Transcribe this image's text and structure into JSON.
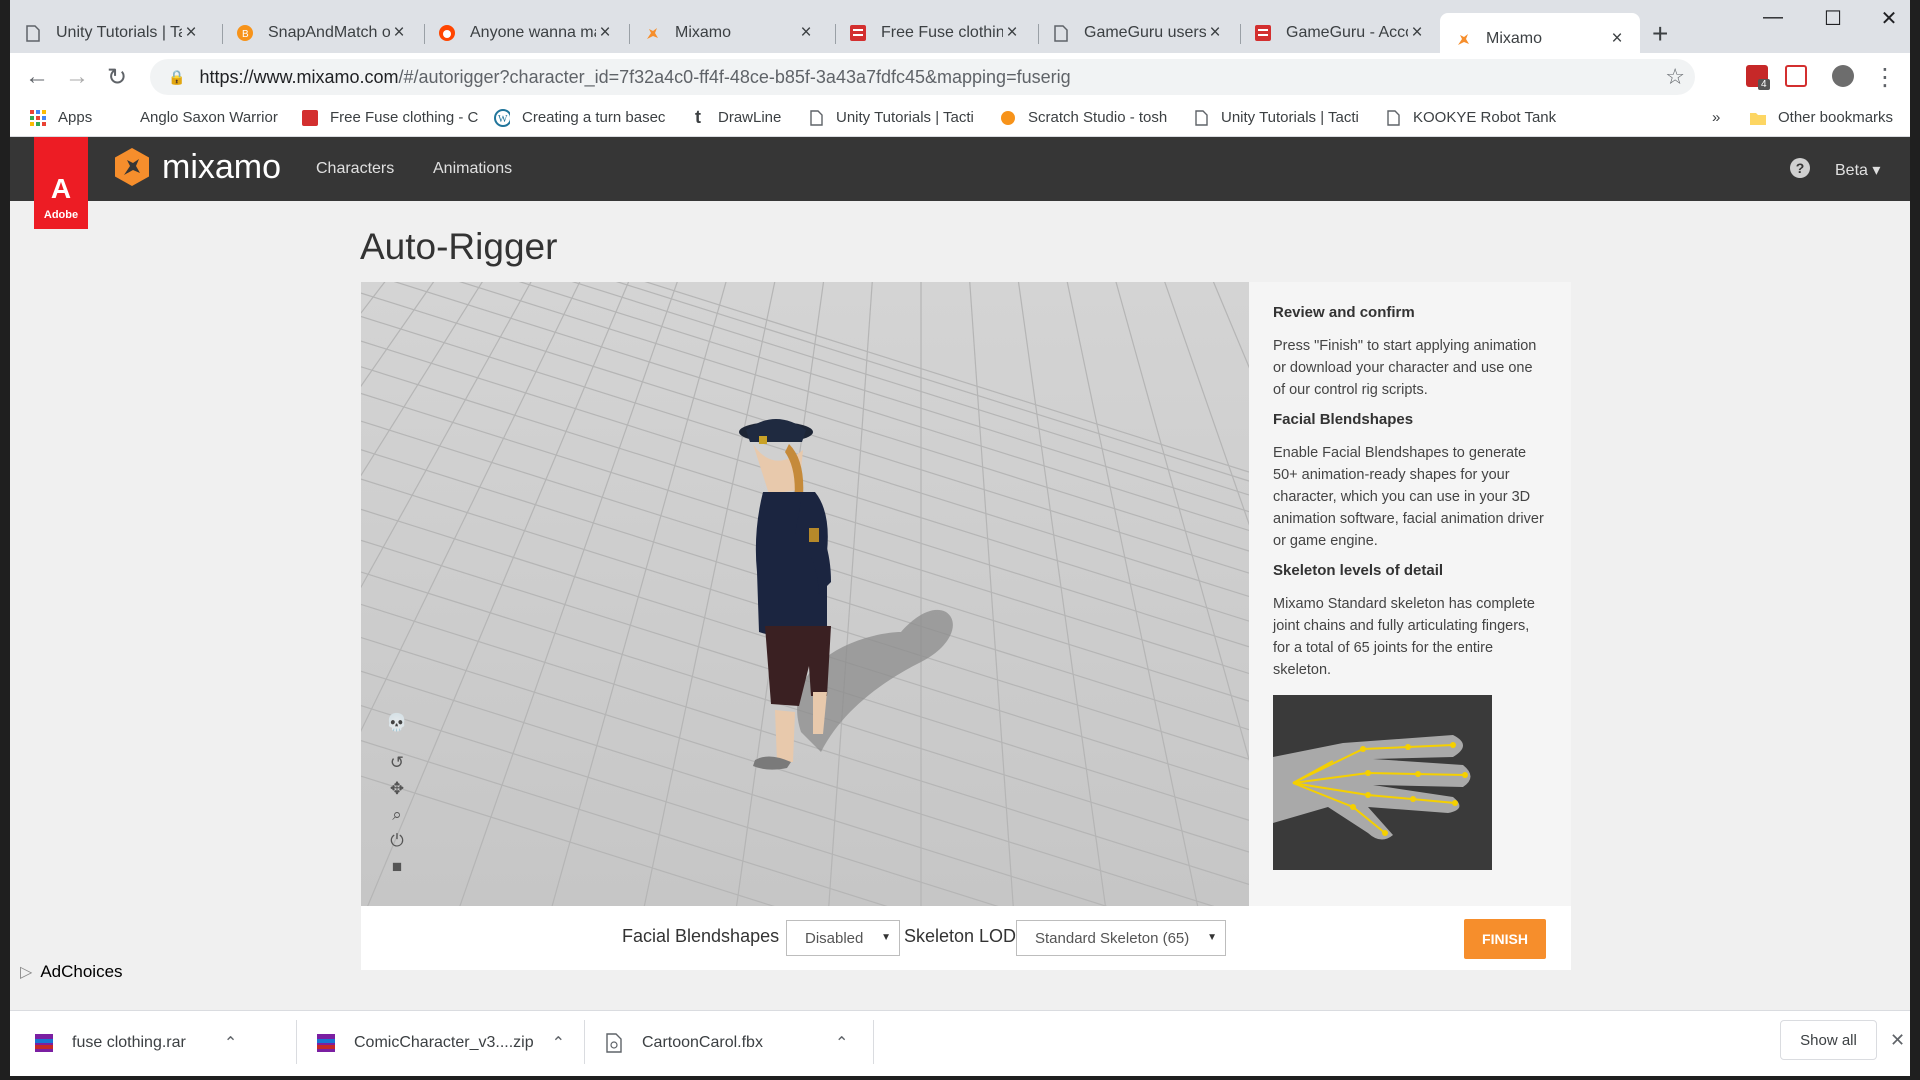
{
  "browser": {
    "tabs": [
      {
        "title": "Unity Tutorials | Ta",
        "icon": "page-icon"
      },
      {
        "title": "SnapAndMatch on",
        "icon": "orange-b-icon"
      },
      {
        "title": "Anyone wanna ma",
        "icon": "reddit-icon"
      },
      {
        "title": "Mixamo",
        "icon": "mixamo-icon"
      },
      {
        "title": "Free Fuse clothing",
        "icon": "gameguru-icon"
      },
      {
        "title": "GameGuru users -",
        "icon": "page-icon"
      },
      {
        "title": "GameGuru - Acco",
        "icon": "gameguru-icon"
      },
      {
        "title": "Mixamo",
        "icon": "mixamo-icon"
      }
    ],
    "url_host": "https://www.mixamo.com",
    "url_rest": "/#/autorigger?character_id=7f32a4c0-ff4f-48ce-b85f-3a43a7fdfc45&mapping=fuserig",
    "ext_badge": "4"
  },
  "bookmarks": [
    {
      "label": "Apps",
      "icon": "apps-grid-icon"
    },
    {
      "label": "Anglo Saxon Warrior",
      "icon": ""
    },
    {
      "label": "Free Fuse clothing - C",
      "icon": "gameguru-icon"
    },
    {
      "label": "Creating a turn basec",
      "icon": "wordpress-icon"
    },
    {
      "label": "DrawLine",
      "icon": "tumblr-icon"
    },
    {
      "label": "Unity Tutorials | Tacti",
      "icon": "page-icon"
    },
    {
      "label": "Scratch Studio - tosh",
      "icon": "orange-b-icon"
    },
    {
      "label": "Unity Tutorials | Tacti",
      "icon": "page-icon"
    },
    {
      "label": "KOOKYE Robot Tank",
      "icon": "page-icon"
    },
    {
      "label": "»",
      "icon": ""
    },
    {
      "label": "Other bookmarks",
      "icon": "folder-icon"
    }
  ],
  "mixamo": {
    "adobe_label": "Adobe",
    "logo_text": "mixamo",
    "nav": {
      "characters": "Characters",
      "animations": "Animations"
    },
    "help": "?",
    "beta": "Beta"
  },
  "page": {
    "title": "Auto-Rigger",
    "side": {
      "review_heading": "Review and confirm",
      "review_text": "Press \"Finish\" to start applying animation or download your character and use one of our control rig scripts.",
      "facial_heading": "Facial Blendshapes",
      "facial_text": "Enable Facial Blendshapes to generate 50+ animation-ready shapes for your character, which you can use in your 3D animation software, facial animation driver or game engine.",
      "skeleton_heading": "Skeleton levels of detail",
      "skeleton_text": "Mixamo Standard skeleton has complete joint chains and fully articulating fingers, for a total of 65 joints for the entire skeleton."
    },
    "controls": {
      "facial_label": "Facial Blendshapes",
      "facial_value": "Disabled",
      "lod_label": "Skeleton LOD",
      "lod_value": "Standard Skeleton (65)",
      "finish": "FINISH"
    }
  },
  "adchoices": "AdChoices",
  "downloads": [
    {
      "name": "fuse clothing.rar"
    },
    {
      "name": "ComicCharacter_v3....zip"
    },
    {
      "name": "CartoonCarol.fbx"
    }
  ],
  "show_all": "Show all",
  "colors": {
    "accent": "#f68e2c",
    "adobe": "#ed1c24",
    "header": "#363636"
  }
}
